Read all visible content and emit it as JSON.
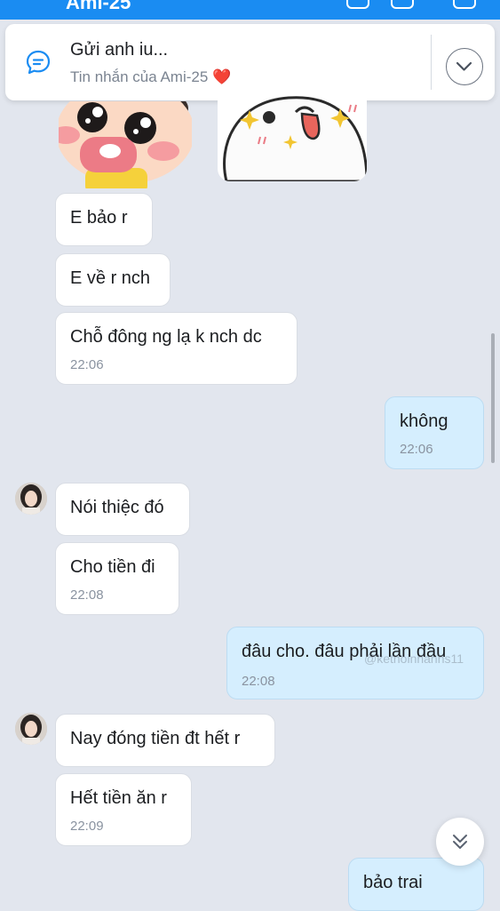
{
  "header": {
    "title": "Ami-25"
  },
  "pinned": {
    "title": "Gửi anh iu...",
    "subtitle": "Tin nhắn của Ami-25 ❤️"
  },
  "messages": [
    {
      "side": "them",
      "text": "E bảo r"
    },
    {
      "side": "them",
      "text": "E về r nch"
    },
    {
      "side": "them",
      "text": "Chỗ đông ng lạ k nch dc",
      "time": "22:06"
    },
    {
      "side": "me",
      "text": "không",
      "time": "22:06"
    },
    {
      "side": "them",
      "text": "Nói thiệc đó"
    },
    {
      "side": "them",
      "text": "Cho tiền đi",
      "time": "22:08"
    },
    {
      "side": "me",
      "text": "đâu cho. đâu phải lần đầu",
      "time": "22:08"
    },
    {
      "side": "them",
      "text": "Nay đóng tiền đt hết r"
    },
    {
      "side": "them",
      "text": "Hết tiền ăn r",
      "time": "22:09"
    },
    {
      "side": "me",
      "text": "bảo trai "
    }
  ],
  "watermark": "@ketnoinnanhs11",
  "icons": {
    "pinned": "chat-bubble-icon",
    "collapse": "chevron-down-icon",
    "scroll": "double-chevron-down-icon"
  }
}
